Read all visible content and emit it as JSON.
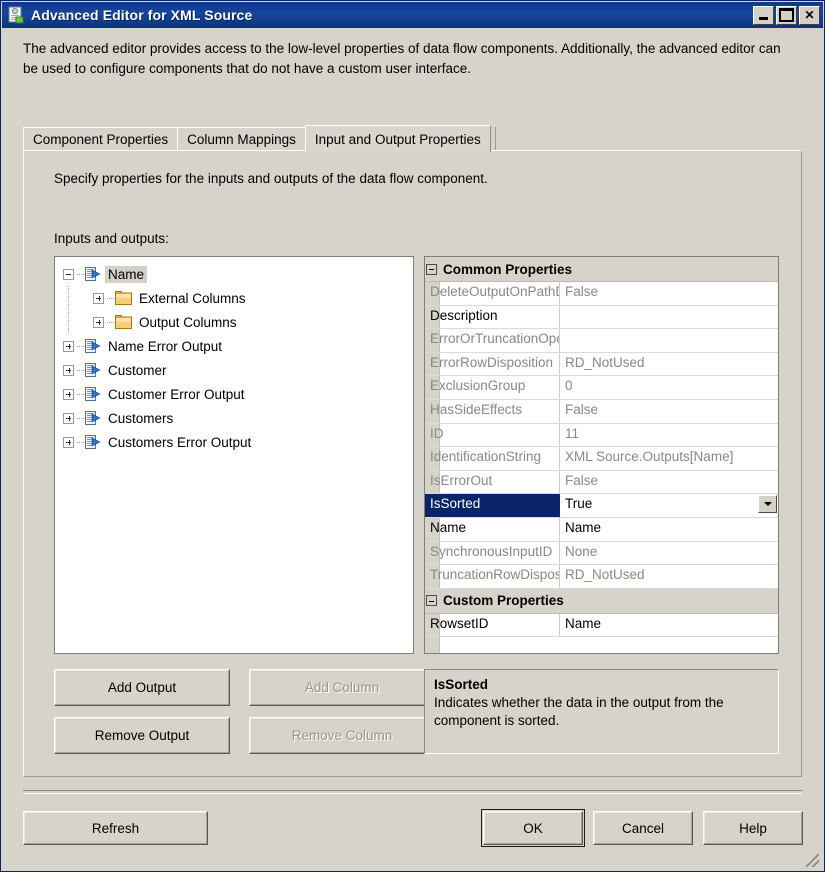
{
  "window": {
    "title": "Advanced Editor for XML Source",
    "icon": "xml-source-icon",
    "controls": {
      "minimize": "_",
      "maximize": "□",
      "close": "✕"
    }
  },
  "intro": "The advanced editor provides access to the low-level properties of data flow components. Additionally, the advanced editor can be used to configure components that do not have a custom user interface.",
  "tabs": [
    {
      "label": "Component Properties",
      "selected": false
    },
    {
      "label": "Column Mappings",
      "selected": false
    },
    {
      "label": "Input and Output Properties",
      "selected": true
    }
  ],
  "page": {
    "hint": "Specify properties for the inputs and outputs of the data flow component.",
    "tree_label": "Inputs and outputs:"
  },
  "tree": [
    {
      "label": "Name",
      "icon": "output-icon",
      "depth": 0,
      "expander": "minus",
      "selected": true
    },
    {
      "label": "External Columns",
      "icon": "folder-icon",
      "depth": 1,
      "expander": "plus",
      "selected": false
    },
    {
      "label": "Output Columns",
      "icon": "folder-icon",
      "depth": 1,
      "expander": "plus",
      "selected": false
    },
    {
      "label": "Name Error Output",
      "icon": "output-icon",
      "depth": 0,
      "expander": "plus",
      "selected": false
    },
    {
      "label": "Customer",
      "icon": "output-icon",
      "depth": 0,
      "expander": "plus",
      "selected": false
    },
    {
      "label": "Customer Error Output",
      "icon": "output-icon",
      "depth": 0,
      "expander": "plus",
      "selected": false
    },
    {
      "label": "Customers",
      "icon": "output-icon",
      "depth": 0,
      "expander": "plus",
      "selected": false
    },
    {
      "label": "Customers Error Output",
      "icon": "output-icon",
      "depth": 0,
      "expander": "plus",
      "selected": false
    }
  ],
  "tree_buttons": {
    "add_output": "Add Output",
    "add_column": "Add Column",
    "remove_output": "Remove Output",
    "remove_column": "Remove Column",
    "add_column_enabled": false,
    "remove_column_enabled": false
  },
  "grid": {
    "groups": [
      {
        "title": "Common Properties",
        "rows": [
          {
            "key": "DeleteOutputOnPathD",
            "value": "False",
            "enabled": false,
            "selected": false
          },
          {
            "key": "Description",
            "value": "",
            "enabled": true,
            "selected": false
          },
          {
            "key": "ErrorOrTruncationOpe",
            "value": "",
            "enabled": false,
            "selected": false
          },
          {
            "key": "ErrorRowDisposition",
            "value": "RD_NotUsed",
            "enabled": false,
            "selected": false
          },
          {
            "key": "ExclusionGroup",
            "value": "0",
            "enabled": false,
            "selected": false
          },
          {
            "key": "HasSideEffects",
            "value": "False",
            "enabled": false,
            "selected": false
          },
          {
            "key": "ID",
            "value": "11",
            "enabled": false,
            "selected": false
          },
          {
            "key": "IdentificationString",
            "value": "XML Source.Outputs[Name]",
            "enabled": false,
            "selected": false
          },
          {
            "key": "IsErrorOut",
            "value": "False",
            "enabled": false,
            "selected": false
          },
          {
            "key": "IsSorted",
            "value": "True",
            "enabled": true,
            "selected": true,
            "dropdown": true
          },
          {
            "key": "Name",
            "value": "Name",
            "enabled": true,
            "selected": false
          },
          {
            "key": "SynchronousInputID",
            "value": "None",
            "enabled": false,
            "selected": false
          },
          {
            "key": "TruncationRowDisposit",
            "value": "RD_NotUsed",
            "enabled": false,
            "selected": false
          }
        ]
      },
      {
        "title": "Custom Properties",
        "rows": [
          {
            "key": "RowsetID",
            "value": "Name",
            "enabled": true,
            "selected": false
          }
        ]
      }
    ]
  },
  "description": {
    "title": "IsSorted",
    "body": "Indicates whether the data in the output from the component is sorted."
  },
  "footer": {
    "refresh": "Refresh",
    "ok": "OK",
    "cancel": "Cancel",
    "help": "Help"
  },
  "colors": {
    "titlebar": "#0a3a8c",
    "selection": "#0a246a",
    "face": "#d6d3ca",
    "disabled_text": "#8b8882"
  }
}
